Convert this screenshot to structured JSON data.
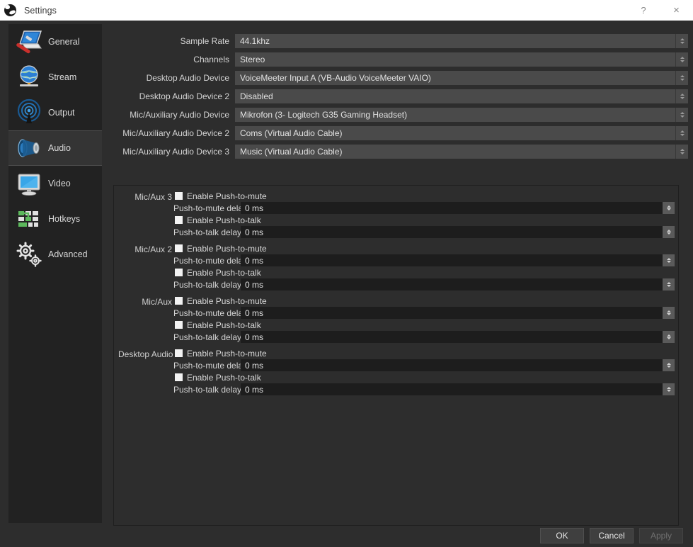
{
  "window": {
    "title": "Settings",
    "app_icon": "obs-logo-icon",
    "help_button": "?",
    "close_button": "×"
  },
  "sidebar": {
    "items": [
      {
        "label": "General",
        "icon": "general-icon",
        "selected": false
      },
      {
        "label": "Stream",
        "icon": "stream-icon",
        "selected": false
      },
      {
        "label": "Output",
        "icon": "output-icon",
        "selected": false
      },
      {
        "label": "Audio",
        "icon": "audio-icon",
        "selected": true
      },
      {
        "label": "Video",
        "icon": "video-icon",
        "selected": false
      },
      {
        "label": "Hotkeys",
        "icon": "hotkeys-icon",
        "selected": false
      },
      {
        "label": "Advanced",
        "icon": "advanced-icon",
        "selected": false
      }
    ]
  },
  "audio_settings": {
    "combos": [
      {
        "label": "Sample Rate",
        "value": "44.1khz"
      },
      {
        "label": "Channels",
        "value": "Stereo"
      },
      {
        "label": "Desktop Audio Device",
        "value": "VoiceMeeter Input A (VB-Audio VoiceMeeter VAIO)"
      },
      {
        "label": "Desktop Audio Device 2",
        "value": "Disabled"
      },
      {
        "label": "Mic/Auxiliary Audio Device",
        "value": "Mikrofon (3- Logitech G35 Gaming Headset)"
      },
      {
        "label": "Mic/Auxiliary Audio Device 2",
        "value": "Coms (Virtual Audio Cable)"
      },
      {
        "label": "Mic/Auxiliary Audio Device 3",
        "value": "Music (Virtual Audio Cable)"
      }
    ],
    "push_sections": [
      {
        "group": "Mic/Aux 3",
        "push_to_mute_label": "Enable Push-to-mute",
        "push_to_mute_checked": false,
        "push_to_mute_delay_label": "Push-to-mute delay",
        "push_to_mute_delay_value": "0 ms",
        "push_to_talk_label": "Enable Push-to-talk",
        "push_to_talk_checked": false,
        "push_to_talk_delay_label": "Push-to-talk delay",
        "push_to_talk_delay_value": "0 ms"
      },
      {
        "group": "Mic/Aux 2",
        "push_to_mute_label": "Enable Push-to-mute",
        "push_to_mute_checked": false,
        "push_to_mute_delay_label": "Push-to-mute delay",
        "push_to_mute_delay_value": "0 ms",
        "push_to_talk_label": "Enable Push-to-talk",
        "push_to_talk_checked": false,
        "push_to_talk_delay_label": "Push-to-talk delay",
        "push_to_talk_delay_value": "0 ms"
      },
      {
        "group": "Mic/Aux",
        "push_to_mute_label": "Enable Push-to-mute",
        "push_to_mute_checked": false,
        "push_to_mute_delay_label": "Push-to-mute delay",
        "push_to_mute_delay_value": "0 ms",
        "push_to_talk_label": "Enable Push-to-talk",
        "push_to_talk_checked": false,
        "push_to_talk_delay_label": "Push-to-talk delay",
        "push_to_talk_delay_value": "0 ms"
      },
      {
        "group": "Desktop Audio",
        "push_to_mute_label": "Enable Push-to-mute",
        "push_to_mute_checked": false,
        "push_to_mute_delay_label": "Push-to-mute delay",
        "push_to_mute_delay_value": "0 ms",
        "push_to_talk_label": "Enable Push-to-talk",
        "push_to_talk_checked": false,
        "push_to_talk_delay_label": "Push-to-talk delay",
        "push_to_talk_delay_value": "0 ms"
      }
    ]
  },
  "footer": {
    "ok_label": "OK",
    "cancel_label": "Cancel",
    "apply_label": "Apply",
    "apply_enabled": false
  }
}
